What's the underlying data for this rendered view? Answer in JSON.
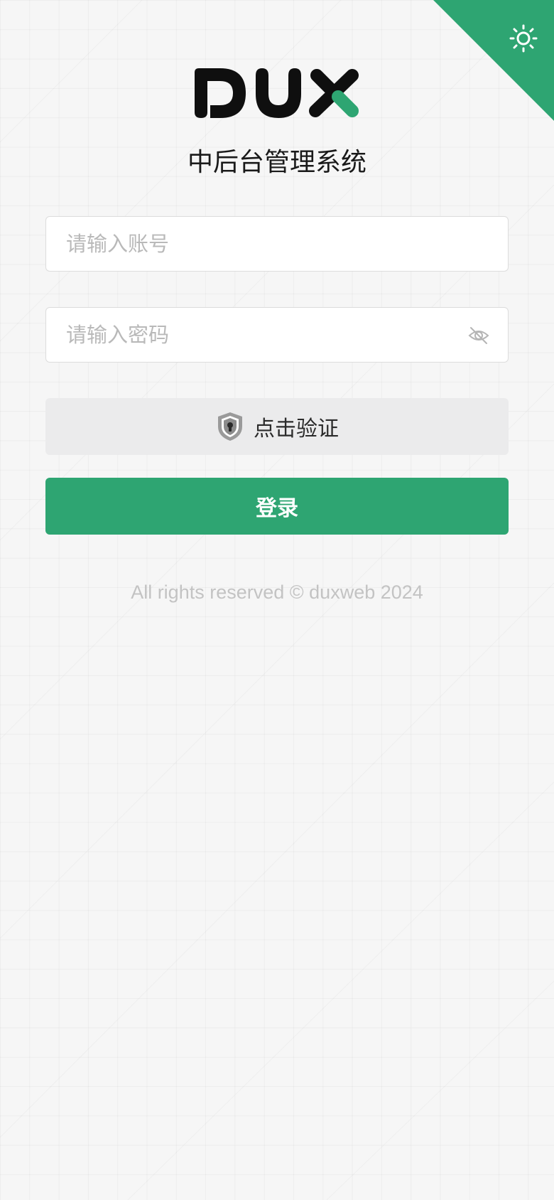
{
  "app": {
    "subtitle": "中后台管理系统",
    "logo_text": "DUX"
  },
  "theme_toggle": {
    "icon": "sun-icon",
    "color": "#2ea572"
  },
  "form": {
    "account_placeholder": "请输入账号",
    "password_placeholder": "请输入密码",
    "password_toggle_icon": "eye-off-icon",
    "verify_label": "点击验证",
    "verify_icon": "shield-lock-icon",
    "login_label": "登录"
  },
  "footer": {
    "copyright": "All rights reserved © duxweb 2024"
  },
  "colors": {
    "accent": "#2ea572",
    "background": "#f6f6f6"
  }
}
